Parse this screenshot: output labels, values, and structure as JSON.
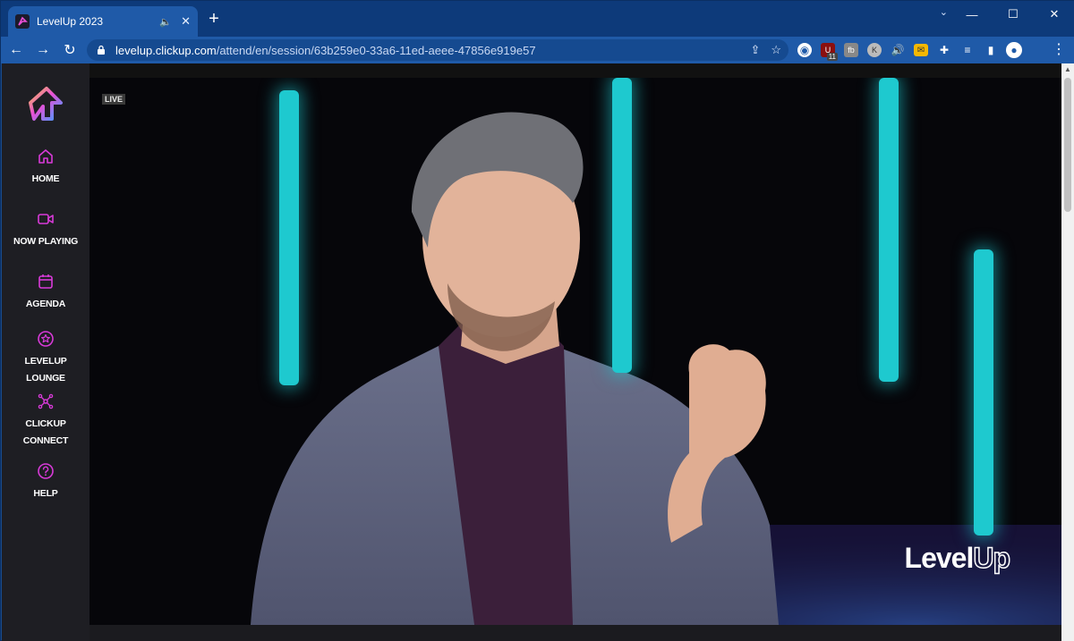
{
  "browser": {
    "tab": {
      "title": "LevelUp 2023"
    },
    "url": {
      "host": "levelup.clickup.com",
      "path": "/attend/en/session/63b259e0-33a6-11ed-aeee-47856e919e57"
    },
    "extensions": [
      {
        "icon": "onepassword-icon",
        "glyph": "◉"
      },
      {
        "icon": "ublock-icon",
        "glyph": "U",
        "badge": "11"
      },
      {
        "icon": "fb-icon",
        "glyph": "fb"
      },
      {
        "icon": "k-icon",
        "glyph": "K"
      },
      {
        "icon": "volume-icon",
        "glyph": "🔊"
      },
      {
        "icon": "mail-icon",
        "glyph": "✉"
      },
      {
        "icon": "puzzle-icon",
        "glyph": "✚"
      },
      {
        "icon": "playlist-icon",
        "glyph": "≡"
      },
      {
        "icon": "sidepanel-icon",
        "glyph": "▮"
      },
      {
        "icon": "profile-icon",
        "glyph": "●"
      }
    ]
  },
  "sidebar": {
    "items": [
      {
        "label_lines": [
          "HOME"
        ],
        "icon": "home-icon"
      },
      {
        "label_lines": [
          "NOW PLAYING"
        ],
        "icon": "video-camera-icon"
      },
      {
        "label_lines": [
          "AGENDA"
        ],
        "icon": "calendar-icon"
      },
      {
        "label_lines": [
          "LEVELUP",
          "LOUNGE"
        ],
        "icon": "star-circle-icon"
      },
      {
        "label_lines": [
          "CLICKUP",
          "CONNECT"
        ],
        "icon": "network-icon"
      },
      {
        "label_lines": [
          "HELP"
        ],
        "icon": "help-circle-icon"
      }
    ]
  },
  "video": {
    "live_label": "LIVE",
    "brand_prefix": "Level",
    "brand_suffix": "Up"
  },
  "colors": {
    "accent": "#d93ad9",
    "neon": "#1ec9cf",
    "sidebar_bg": "#1e1e23"
  }
}
